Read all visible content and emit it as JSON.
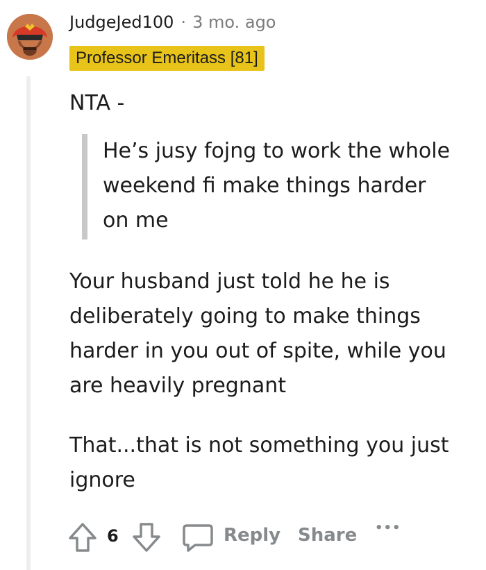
{
  "comment": {
    "username": "JudgeJed100",
    "separator": "·",
    "timestamp": "3 mo. ago",
    "flair": "Professor Emeritass [81]",
    "opening": "NTA -",
    "quote_lines": [
      "He’s jusy fojng to work the whole",
      "weekend fi make things harder",
      "on me"
    ],
    "body_lines": [
      "Your husband just told he he is",
      "deliberately going to make things",
      "harder in you out of spite, while you",
      "are heavily pregnant"
    ],
    "closing_lines": [
      "That...that is not something you just",
      "ignore"
    ]
  },
  "actions": {
    "vote_count": "6",
    "reply_label": "Reply",
    "share_label": "Share",
    "more_label": "•••"
  },
  "icons": {
    "avatar": "avatar-judge-helmet",
    "upvote": "upvote-arrow-icon",
    "downvote": "downvote-arrow-icon",
    "reply": "comment-bubble-icon",
    "more": "more-options-icon"
  },
  "colors": {
    "flair_bg": "#e8c31a",
    "muted_text": "#878a8c",
    "thread_line": "#eeeeee",
    "quote_bar": "#c8c8c8"
  }
}
